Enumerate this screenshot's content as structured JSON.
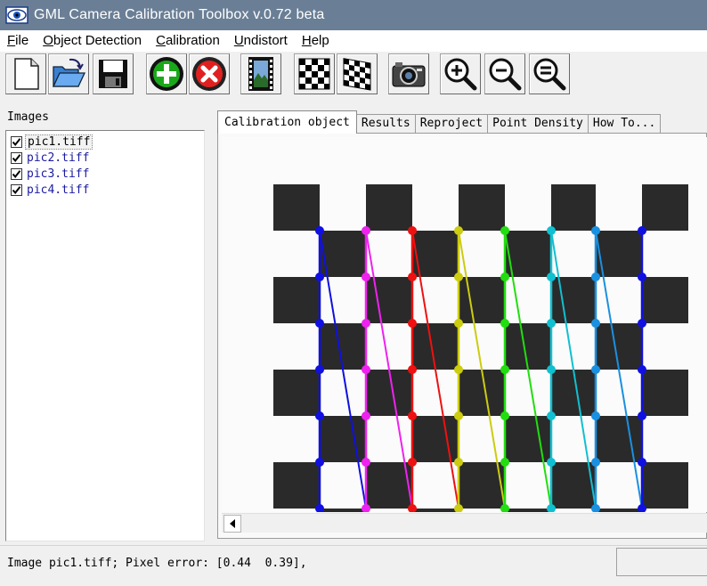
{
  "window": {
    "title": "GML Camera Calibration Toolbox  v.0.72 beta"
  },
  "menu": [
    {
      "label": "File",
      "ul": "F",
      "rest": "ile"
    },
    {
      "label": "Object Detection",
      "ul": "O",
      "rest": "bject Detection"
    },
    {
      "label": "Calibration",
      "ul": "C",
      "rest": "alibration"
    },
    {
      "label": "Undistort",
      "ul": "U",
      "rest": "ndistort"
    },
    {
      "label": "Help",
      "ul": "H",
      "rest": "elp"
    }
  ],
  "toolbar": {
    "icons": [
      "new-file-icon",
      "open-folder-icon",
      "save-disk-icon",
      "add-green-icon",
      "remove-red-icon",
      "film-strip-icon",
      "chessboard-icon",
      "chessboard-skewed-icon",
      "camera-icon",
      "zoom-in-icon",
      "zoom-out-icon",
      "zoom-fit-icon"
    ]
  },
  "images_panel": {
    "label": "Images",
    "items": [
      {
        "name": "pic1.tiff",
        "checked": true,
        "selected": true
      },
      {
        "name": "pic2.tiff",
        "checked": true,
        "selected": false
      },
      {
        "name": "pic3.tiff",
        "checked": true,
        "selected": false
      },
      {
        "name": "pic4.tiff",
        "checked": true,
        "selected": false
      }
    ]
  },
  "tabs": [
    {
      "label": "Calibration object",
      "active": true
    },
    {
      "label": "Results",
      "active": false
    },
    {
      "label": "Reproject",
      "active": false
    },
    {
      "label": "Point Density",
      "active": false
    },
    {
      "label": "How To...",
      "active": false
    }
  ],
  "overlay": {
    "column_colors": [
      "#1010e0",
      "#ee22ee",
      "#ee1111",
      "#cccc10",
      "#22dd10",
      "#10c0d0",
      "#1a90e0",
      "#1010e0"
    ],
    "board_color": "#2a2a2a"
  },
  "status": {
    "text": "Image pic1.tiff; Pixel error: [0.44  0.39],"
  }
}
